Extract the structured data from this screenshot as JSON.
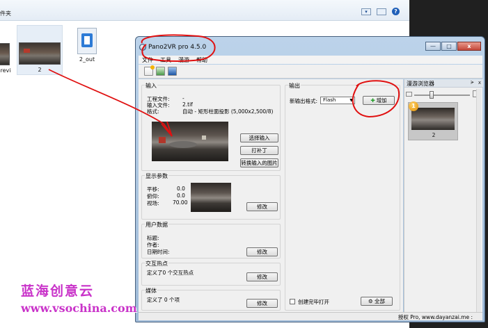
{
  "explorer": {
    "folder_label": "件夹",
    "files": [
      {
        "label": "revi"
      },
      {
        "label": "2"
      },
      {
        "label": "2_out"
      }
    ],
    "help_glyph": "?"
  },
  "window": {
    "title": "Pano2VR pro 4.5.0",
    "controls": {
      "minimize": "—",
      "maximize": "□",
      "close": "x"
    },
    "menu": [
      "文件",
      "工具",
      "漫游",
      "帮助"
    ]
  },
  "input_group": {
    "title": "输入",
    "project_file_label": "工程文件:",
    "project_file_value": "-",
    "input_file_label": "输入文件:",
    "input_file_value": "2.tif",
    "format_label": "格式:",
    "format_value": "自动 - 矩形柱面投影 (5,000x2,500/8)",
    "buttons": {
      "select_input": "选择输入",
      "patch": "打补丁",
      "convert": "转换输入的图片"
    }
  },
  "view_group": {
    "title": "显示参数",
    "pan_label": "平移:",
    "pan_value": "0.0",
    "tilt_label": "俯仰:",
    "tilt_value": "0.0",
    "fov_label": "视场:",
    "fov_value": "70.00",
    "modify": "修改"
  },
  "user_data_group": {
    "title": "用户数据",
    "title_label": "标题:",
    "author_label": "作者:",
    "datetime_label": "日期时间:",
    "modify": "修改"
  },
  "hotspot_group": {
    "title": "交互热点",
    "summary": "定义了0 个交互热点",
    "modify": "修改"
  },
  "media_group": {
    "title": "媒体",
    "summary": "定义了 0 个项",
    "modify": "修改"
  },
  "output_group": {
    "title": "输出",
    "format_label": "新输出格式:",
    "format_value": "Flash",
    "add_button": "增加",
    "open_after_label": "创建完毕打开",
    "all_button": "全部"
  },
  "tour_browser": {
    "title": "漫游浏览器",
    "pin": "ᗒ",
    "close": "x",
    "tile": {
      "badge": "1",
      "label": "2"
    }
  },
  "status": {
    "text": "授权 Pro, www.dayanzai.me :"
  },
  "watermark": {
    "chinese": "蓝海创意云",
    "url": "www.vsochina.com"
  },
  "colors": {
    "annotation_red": "#e01010",
    "watermark_purple": "#c933c9",
    "add_icon_green": "#1f9c25"
  }
}
